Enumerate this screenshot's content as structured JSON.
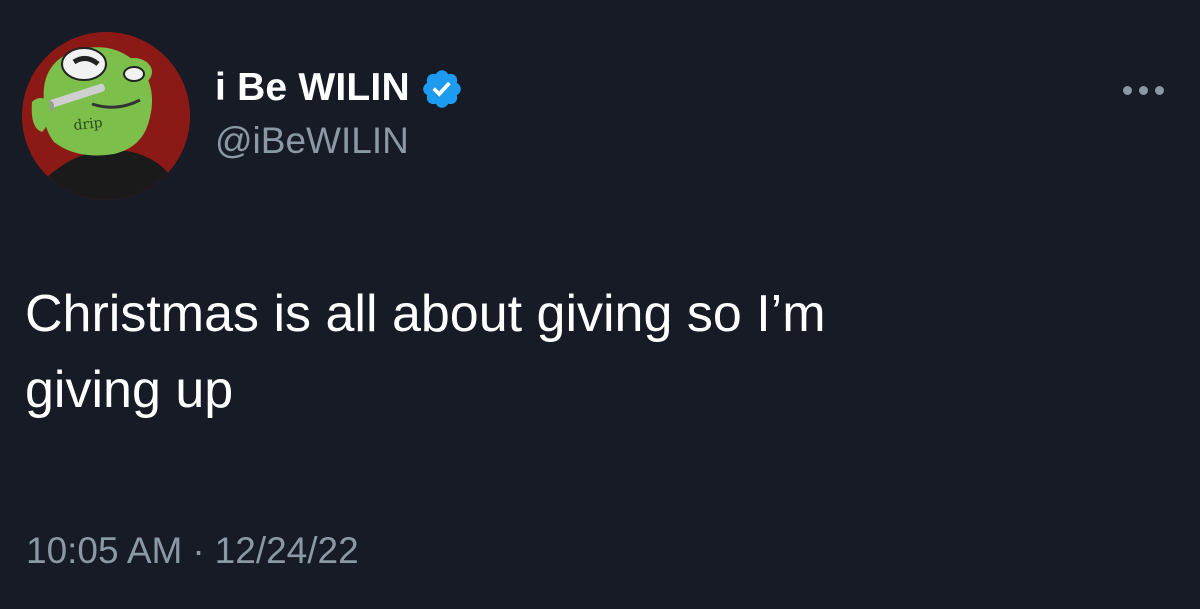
{
  "tweet": {
    "display_name": "i Be WILIN",
    "handle": "@iBeWILIN",
    "verified": true,
    "text": "Christmas is all about giving so I’m\ngiving up",
    "time": "10:05 AM",
    "separator": "·",
    "date": "12/24/22"
  },
  "avatar": {
    "icon": "frog-cartoon-avatar",
    "scribble_text": "drip"
  },
  "icons": {
    "verified": "verified-badge-icon",
    "more": "more-horizontal-icon"
  },
  "colors": {
    "background": "#161b26",
    "text_primary": "#ffffff",
    "text_secondary": "#8b98a5",
    "verified_blue": "#1d9bf0",
    "avatar_background": "#8b1a16",
    "frog_green": "#7cc04b"
  }
}
